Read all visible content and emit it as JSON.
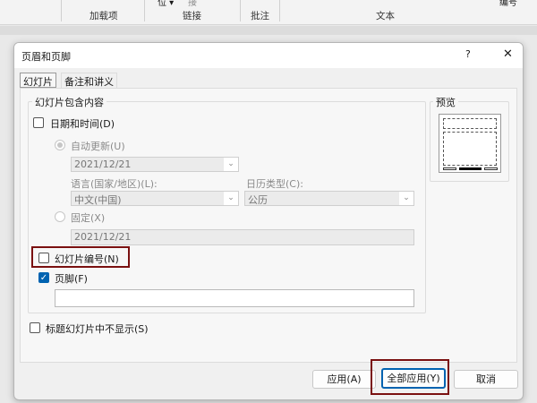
{
  "ribbon": {
    "partial_top": [
      "位 ▾",
      "接",
      "编号"
    ],
    "groups": [
      "加载项",
      "链接",
      "批注",
      "文本"
    ]
  },
  "dialog": {
    "title": "页眉和页脚",
    "help": "?",
    "close": "✕",
    "tabs": [
      "幻灯片",
      "备注和讲义"
    ],
    "include_group": "幻灯片包含内容",
    "date_time": {
      "label": "日期和时间(D)",
      "checked": false
    },
    "auto_update": {
      "label": "自动更新(U)",
      "selected": true
    },
    "auto_date": "2021/12/21",
    "language_label": "语言(国家/地区)(L):",
    "language_value": "中文(中国)",
    "calendar_label": "日历类型(C):",
    "calendar_value": "公历",
    "fixed": {
      "label": "固定(X)",
      "selected": false
    },
    "fixed_value": "2021/12/21",
    "slide_number": {
      "label": "幻灯片编号(N)",
      "checked": false
    },
    "footer": {
      "label": "页脚(F)",
      "checked": true,
      "value": ""
    },
    "no_title_slide": {
      "label": "标题幻灯片中不显示(S)",
      "checked": false
    },
    "preview_label": "预览",
    "buttons": {
      "apply": "应用(A)",
      "apply_all": "全部应用(Y)",
      "cancel": "取消"
    }
  }
}
